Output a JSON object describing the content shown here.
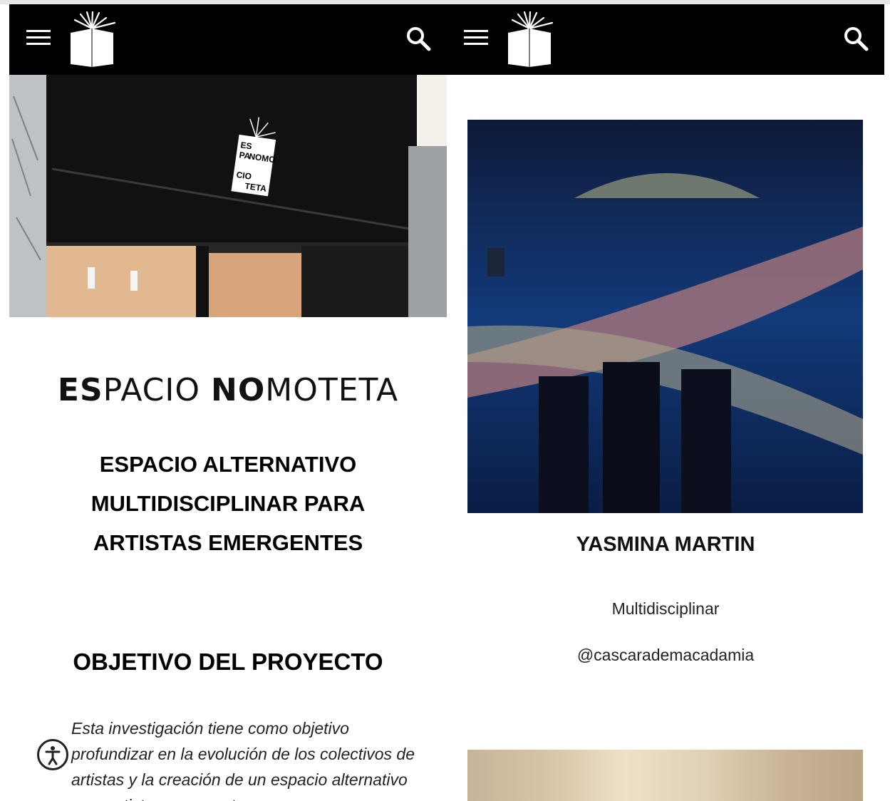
{
  "colors": {
    "navbar_bg": "#000000",
    "nav_icon": "#ffffff",
    "text": "#111111"
  },
  "left_panel": {
    "navbar": {
      "menu_icon": "hamburger-menu-icon",
      "logo_icon": "book-burst-logo-icon",
      "search_icon": "search-icon"
    },
    "hero_sign_lines": [
      "ES",
      "PA",
      "NOMO",
      "CIO",
      "TETA"
    ],
    "brand_title": {
      "part1_bold": "ES",
      "part2": "PACIO ",
      "part3_bold": "NO",
      "part4": "MOTETA"
    },
    "subtitle_lines": [
      "ESPACIO ALTERNATIVO",
      "MULTIDISCIPLINAR PARA",
      "ARTISTAS EMERGENTES"
    ],
    "section_heading": "OBJETIVO DEL PROYECTO",
    "paragraph": "Esta investigación tiene como objetivo profundizar en la evolución de los colectivos de artistas y la creación de un espacio alternativo para artistas emergentes en",
    "accessibility_icon": "accessibility-icon"
  },
  "right_panel": {
    "navbar": {
      "menu_icon": "hamburger-menu-icon",
      "logo_icon": "book-burst-logo-icon",
      "search_icon": "search-icon"
    },
    "artist_name": "YASMINA MARTIN",
    "discipline": "Multidisciplinar",
    "handle": "@cascarademacadamia"
  }
}
